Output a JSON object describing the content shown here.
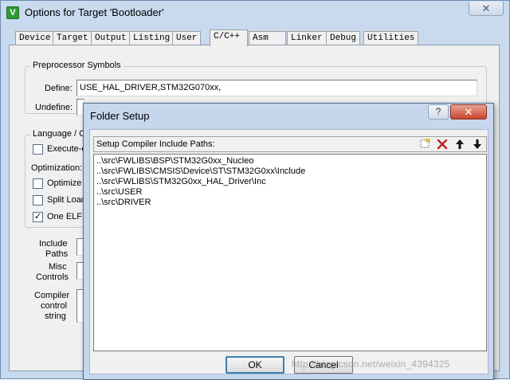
{
  "main_window": {
    "title": "Options for Target 'Bootloader'",
    "icon_letter": "V",
    "close_glyph": "✕"
  },
  "tabs": [
    {
      "label": "Device"
    },
    {
      "label": "Target"
    },
    {
      "label": "Output"
    },
    {
      "label": "Listing"
    },
    {
      "label": "User"
    },
    {
      "label": "C/C++",
      "active": true
    },
    {
      "label": "Asm"
    },
    {
      "label": "Linker"
    },
    {
      "label": "Debug"
    },
    {
      "label": "Utilities"
    }
  ],
  "preprocessor": {
    "group_title": "Preprocessor Symbols",
    "define_label": "Define:",
    "define_value": "USE_HAL_DRIVER,STM32G070xx,",
    "undefine_label": "Undefine:"
  },
  "language": {
    "group_title": "Language / C",
    "execute_only": "Execute-o",
    "optimization_label": "Optimization:",
    "optimize_for": "Optimize f",
    "split_load": "Split Load",
    "one_elf": "One ELF",
    "one_elf_checked": "✓"
  },
  "bottom_labels": {
    "include_paths_1": "Include",
    "include_paths_2": "Paths",
    "misc_controls_1": "Misc",
    "misc_controls_2": "Controls",
    "compiler_control_1": "Compiler",
    "compiler_control_2": "control",
    "compiler_control_3": "string"
  },
  "folder_dialog": {
    "title": "Folder Setup",
    "help_glyph": "?",
    "close_glyph": "✕",
    "paths_label": "Setup Compiler Include Paths:",
    "toolbar": {
      "new_icon": "new-folder-icon",
      "delete_icon": "delete-x-icon",
      "up_icon": "arrow-up-icon",
      "down_icon": "arrow-down-icon",
      "delete_color": "#c0201a"
    },
    "paths": [
      "..\\src\\FWLIBS\\BSP\\STM32G0xx_Nucleo",
      "..\\src\\FWLIBS\\CMSIS\\Device\\ST\\STM32G0xx\\Include",
      "..\\src\\FWLIBS\\STM32G0xx_HAL_Driver\\Inc",
      "..\\src\\USER",
      "..\\src\\DRIVER"
    ],
    "ok_label": "OK",
    "cancel_label": "Cancel"
  },
  "watermark": "http://blog.csdn.net/weixin_4394325"
}
